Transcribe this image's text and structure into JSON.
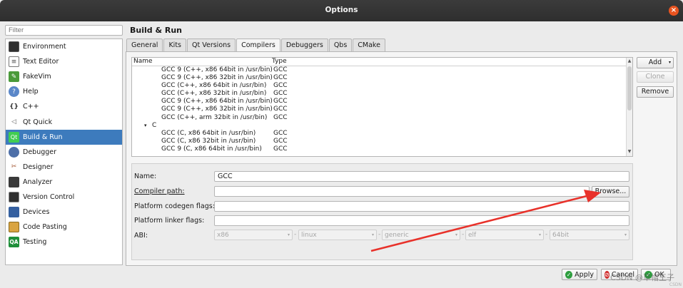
{
  "window": {
    "title": "Options"
  },
  "filter": {
    "placeholder": "Filter"
  },
  "sidebar": {
    "items": [
      {
        "label": "Environment",
        "icon": "monitor-icon"
      },
      {
        "label": "Text Editor",
        "icon": "text-editor-icon"
      },
      {
        "label": "FakeVim",
        "icon": "fakevim-icon"
      },
      {
        "label": "Help",
        "icon": "help-icon"
      },
      {
        "label": "C++",
        "icon": "cpp-braces-icon"
      },
      {
        "label": "Qt Quick",
        "icon": "qt-quick-icon"
      },
      {
        "label": "Build & Run",
        "icon": "build-run-icon",
        "active": true
      },
      {
        "label": "Debugger",
        "icon": "debugger-icon"
      },
      {
        "label": "Designer",
        "icon": "designer-icon"
      },
      {
        "label": "Analyzer",
        "icon": "analyzer-icon"
      },
      {
        "label": "Version Control",
        "icon": "version-control-icon"
      },
      {
        "label": "Devices",
        "icon": "devices-icon"
      },
      {
        "label": "Code Pasting",
        "icon": "code-pasting-icon"
      },
      {
        "label": "Testing",
        "icon": "testing-icon"
      }
    ]
  },
  "main": {
    "title": "Build & Run",
    "tabs": [
      "General",
      "Kits",
      "Qt Versions",
      "Compilers",
      "Debuggers",
      "Qbs",
      "CMake"
    ],
    "active_tab": "Compilers"
  },
  "compilers": {
    "headers": {
      "name": "Name",
      "type": "Type"
    },
    "rows": [
      {
        "name": "GCC 9 (C++, x86 64bit in /usr/bin)",
        "type": "GCC"
      },
      {
        "name": "GCC 9 (C++, x86 32bit in /usr/bin)",
        "type": "GCC"
      },
      {
        "name": "GCC (C++, x86 64bit in /usr/bin)",
        "type": "GCC"
      },
      {
        "name": "GCC (C++, x86 32bit in /usr/bin)",
        "type": "GCC"
      },
      {
        "name": "GCC 9 (C++, x86 64bit in /usr/bin)",
        "type": "GCC"
      },
      {
        "name": "GCC 9 (C++, x86 32bit in /usr/bin)",
        "type": "GCC"
      },
      {
        "name": "GCC (C++, arm 32bit in /usr/bin)",
        "type": "GCC"
      }
    ],
    "group": {
      "arrow": "▾",
      "label": "C"
    },
    "c_rows": [
      {
        "name": "GCC (C, x86 64bit in /usr/bin)",
        "type": "GCC"
      },
      {
        "name": "GCC (C, x86 32bit in /usr/bin)",
        "type": "GCC"
      },
      {
        "name": "GCC 9 (C, x86 64bit in /usr/bin)",
        "type": "GCC"
      }
    ]
  },
  "side_buttons": {
    "add": "Add",
    "clone": "Clone",
    "remove": "Remove"
  },
  "details": {
    "name_label": "Name:",
    "name_value": "GCC",
    "compiler_path_label": "Compiler path:",
    "compiler_path_value": "",
    "browse_label": "Browse...",
    "codegen_label": "Platform codegen flags:",
    "codegen_value": "",
    "linker_label": "Platform linker flags:",
    "linker_value": "",
    "abi_label": "ABI:",
    "abi": [
      "x86",
      "linux",
      "generic",
      "elf",
      "64bit"
    ],
    "abi_sep": "-"
  },
  "footer": {
    "apply": "Apply",
    "cancel": "Cancel",
    "ok": "OK"
  },
  "watermark": {
    "text": "CSDN @草帽王子",
    "sub": "CSDN"
  },
  "colors": {
    "accent": "#3d7bbd",
    "close": "#e95420",
    "annotation_arrow": "#e8312a",
    "apply_icon": "#2e9e3f",
    "cancel_icon": "#d02a2a"
  }
}
